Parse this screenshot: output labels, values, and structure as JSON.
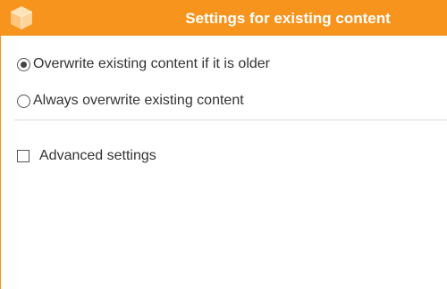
{
  "window": {
    "title": "Settings for existing content",
    "accent_color": "#f7941d",
    "icon": "cube-icon"
  },
  "options": {
    "overwrite_if_older": {
      "label": "Overwrite existing content if it is older",
      "selected": true
    },
    "always_overwrite": {
      "label": "Always overwrite existing content",
      "selected": false
    }
  },
  "advanced": {
    "label": "Advanced settings",
    "checked": false
  }
}
